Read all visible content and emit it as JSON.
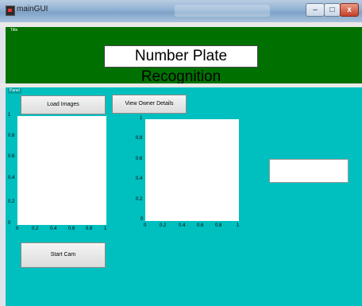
{
  "window": {
    "title": "mainGUI",
    "controls": {
      "minimize": "–",
      "maximize": "□",
      "close": "x"
    }
  },
  "top_panel": {
    "tag": "Title",
    "title": "Number Plate Recognition"
  },
  "main_panel": {
    "tag": "Panel",
    "buttons": {
      "load_images": "Load Images",
      "view_owner_details": "View Owner Details",
      "start_cam": "Start Cam"
    }
  },
  "axes_left": {
    "y_ticks": [
      "1",
      "0.8",
      "0.6",
      "0.4",
      "0.2",
      "0"
    ],
    "x_ticks": [
      "0",
      "0.2",
      "0.4",
      "0.6",
      "0.8",
      "1"
    ]
  },
  "axes_right": {
    "y_ticks": [
      "1",
      "0.8",
      "0.6",
      "0.4",
      "0.2",
      "0"
    ],
    "x_ticks": [
      "0",
      "0.2",
      "0.4",
      "0.6",
      "0.8",
      "1"
    ]
  },
  "result_field": {
    "value": ""
  }
}
